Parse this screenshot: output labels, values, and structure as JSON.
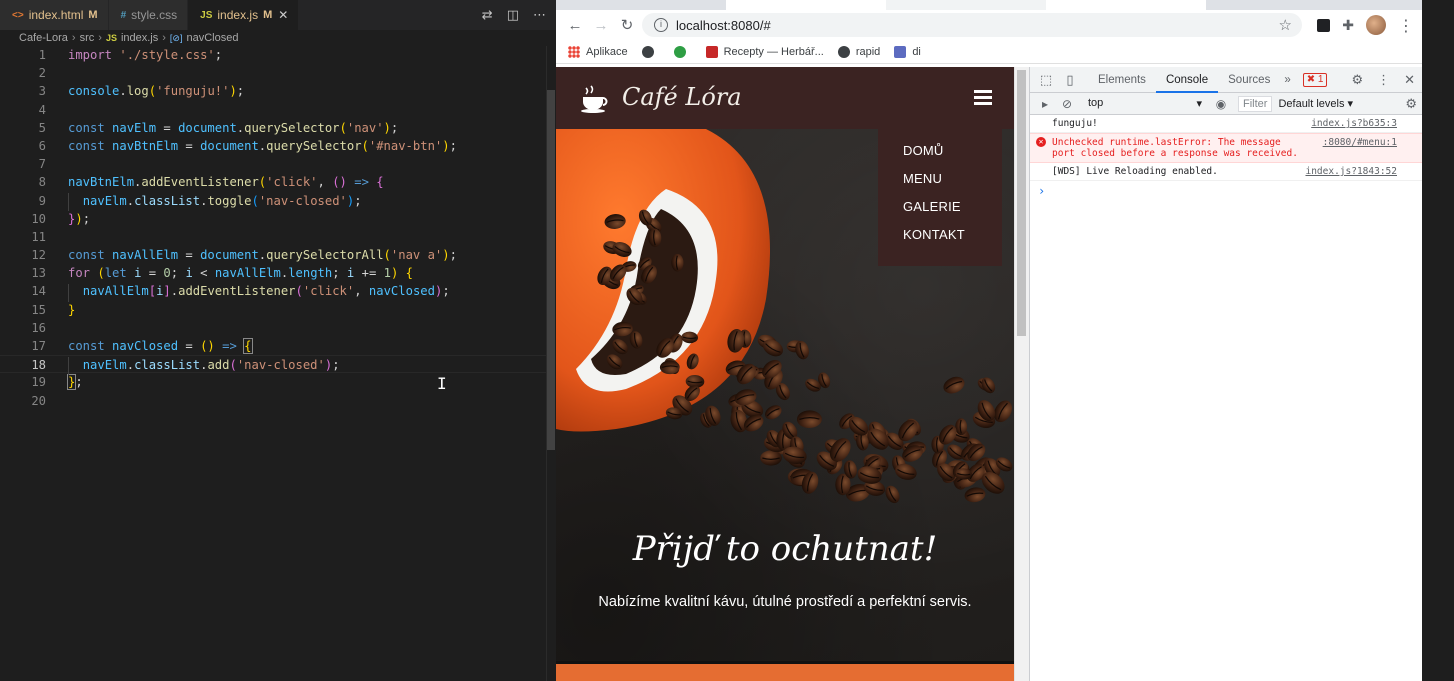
{
  "editor": {
    "tabs": [
      {
        "icon": "<>",
        "name": "index.html",
        "modified": "M"
      },
      {
        "icon": "#",
        "name": "style.css",
        "modified": ""
      },
      {
        "icon": "JS",
        "name": "index.js",
        "modified": "M",
        "close": "✕"
      }
    ],
    "breadcrumb": {
      "project": "Cafe-Lora",
      "folder": "src",
      "file_icon": "JS",
      "file": "index.js",
      "symbol_icon": "[⊘]",
      "symbol": "navClosed"
    },
    "line_numbers": [
      "1",
      "2",
      "3",
      "4",
      "5",
      "6",
      "7",
      "8",
      "9",
      "10",
      "11",
      "12",
      "13",
      "14",
      "15",
      "16",
      "17",
      "18",
      "19",
      "20"
    ],
    "code": {
      "l1_kw": "import",
      "l1_str": "'./style.css'",
      "l1_end": ";",
      "l3_obj": "console",
      "l3_fn": "log",
      "l3_str": "'funguju!'",
      "l3_end": ");",
      "l5_kw": "const",
      "l5_var": "navElm",
      "l5_obj": "document",
      "l5_fn": "querySelector",
      "l5_str": "'nav'",
      "l6_kw": "const",
      "l6_var": "navBtnElm",
      "l6_obj": "document",
      "l6_fn": "querySelector",
      "l6_str": "'#nav-btn'",
      "l8_var": "navBtnElm",
      "l8_fn": "addEventListener",
      "l8_str": "'click'",
      "l9_var": "navElm",
      "l9_prop": "classList",
      "l9_fn": "toggle",
      "l9_str": "'nav-closed'",
      "l12_kw": "const",
      "l12_var": "navAllElm",
      "l12_obj": "document",
      "l12_fn": "querySelectorAll",
      "l12_str": "'nav a'",
      "l13_kw": "for",
      "l13_let": "let",
      "l13_i": "i",
      "l13_zero": "0",
      "l13_var": "navAllElm",
      "l13_prop": "length",
      "l13_one": "1",
      "l14_var": "navAllElm",
      "l14_i": "i",
      "l14_fn": "addEventListener",
      "l14_str": "'click'",
      "l14_arg": "navClosed",
      "l17_kw": "const",
      "l17_var": "navClosed",
      "l18_var": "navElm",
      "l18_prop": "classList",
      "l18_fn": "add",
      "l18_str": "'nav-closed'"
    },
    "current_line": "18"
  },
  "browser": {
    "url": "localhost:8080/#",
    "bookmarks": [
      "Aplikace",
      "",
      "",
      "Recepty — Herbář...",
      "rapid",
      "di"
    ],
    "site": {
      "logo_text": "Café Lóra",
      "nav_items": [
        "DOMŮ",
        "MENU",
        "GALERIE",
        "KONTAKT"
      ],
      "hero_title": "Přijď to ochutnat!",
      "hero_subtitle": "Nabízíme kvalitní kávu, útulné prostředí a perfektní servis."
    },
    "devtools": {
      "tabs": [
        "Elements",
        "Console",
        "Sources"
      ],
      "active_tab": "Console",
      "more": "»",
      "error_count": "1",
      "context": "top",
      "filter_placeholder": "Filter",
      "levels": "Default levels ▾",
      "messages": [
        {
          "text": "funguju!",
          "source": "index.js?b635:3"
        },
        {
          "text": "Unchecked runtime.lastError: The message port closed before a response was received.",
          "line1": "Unchecked runtime.lastError: The message",
          "line2": "port closed before a response was received.",
          "source": ":8080/#menu:1",
          "level": "error"
        },
        {
          "text": "[WDS] Live Reloading enabled.",
          "source": "index.js?1843:52"
        }
      ],
      "prompt": "›"
    }
  }
}
